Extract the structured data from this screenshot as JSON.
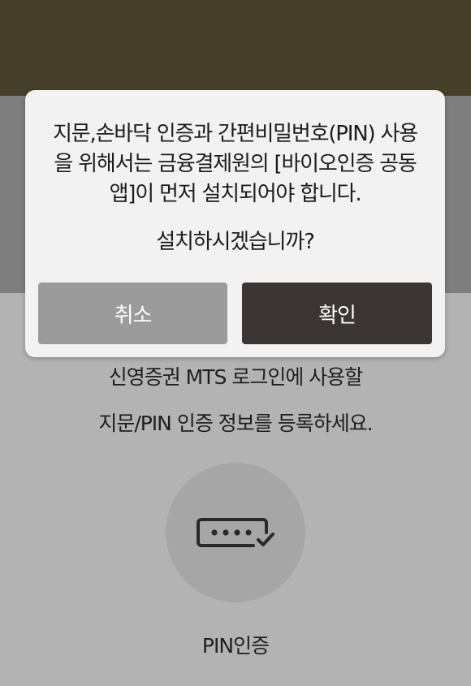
{
  "colors": {
    "header_bg": "#463f2a",
    "overlay_band": "#7e7e7e",
    "page_bg": "#b3b3b3",
    "dialog_bg": "#f2f2f2",
    "cancel_bg": "#9b9b9b",
    "confirm_bg": "#3b3634"
  },
  "dialog": {
    "message_lines": [
      "지문,손바닥 인증과 간편비밀번호(PIN) 사용",
      "을 위해서는 금융결제원의 [바이오인증 공동",
      "앱]이 먼저 설치되어야 합니다."
    ],
    "question": "설치하시겠습니까?",
    "cancel_label": "취소",
    "confirm_label": "확인"
  },
  "main": {
    "intro_lines": [
      "신영증권 MTS 로그인에 사용할",
      "지문/PIN 인증 정보를 등록하세요."
    ],
    "pin_icon": "password-dots-check-icon",
    "pin_label": "PIN인증"
  }
}
